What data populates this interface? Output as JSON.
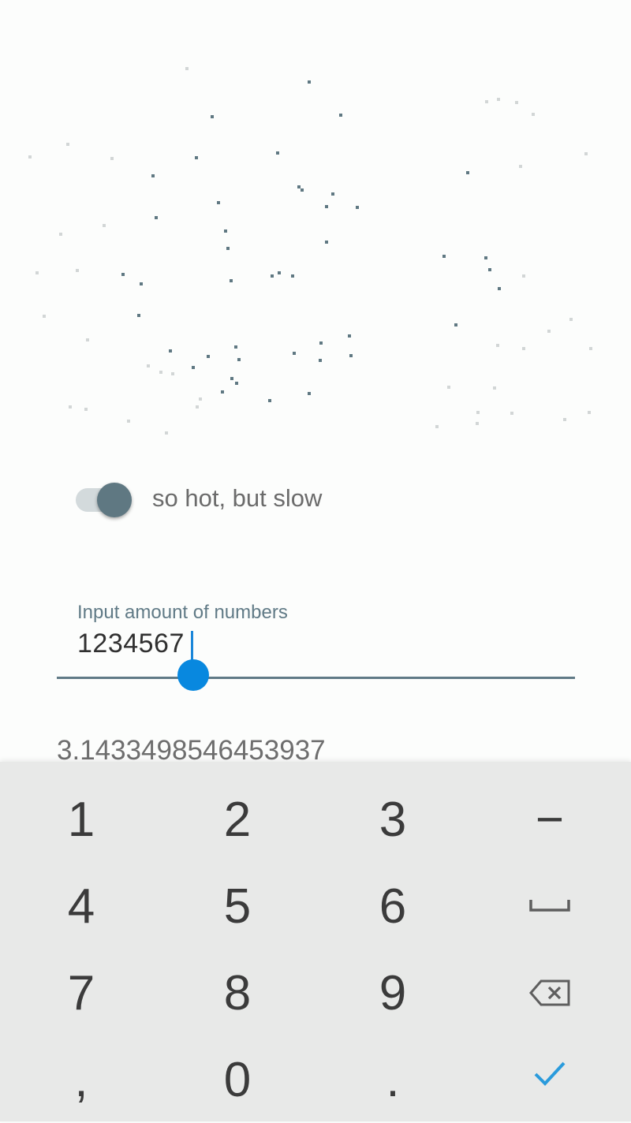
{
  "toggle": {
    "label": "so hot, but slow",
    "on": true
  },
  "input": {
    "label": "Input amount of numbers",
    "value": "1234567"
  },
  "result": {
    "value": "3.1433498546453937"
  },
  "keyboard": {
    "keys": [
      {
        "name": "key-1",
        "label": "1"
      },
      {
        "name": "key-2",
        "label": "2"
      },
      {
        "name": "key-3",
        "label": "3"
      },
      {
        "name": "key-minus",
        "label": "−"
      },
      {
        "name": "key-4",
        "label": "4"
      },
      {
        "name": "key-5",
        "label": "5"
      },
      {
        "name": "key-6",
        "label": "6"
      },
      {
        "name": "key-space",
        "label": "",
        "icon": "space-icon"
      },
      {
        "name": "key-7",
        "label": "7"
      },
      {
        "name": "key-8",
        "label": "8"
      },
      {
        "name": "key-9",
        "label": "9"
      },
      {
        "name": "key-backspace",
        "label": "",
        "icon": "backspace-icon"
      },
      {
        "name": "key-comma",
        "label": ","
      },
      {
        "name": "key-0",
        "label": "0"
      },
      {
        "name": "key-period",
        "label": "."
      },
      {
        "name": "key-done",
        "label": "",
        "icon": "checkmark-icon"
      }
    ]
  },
  "colors": {
    "dot_dark": "#5f7882",
    "dot_light": "#d2d6d6",
    "accent": "#0888df",
    "field": "#607a86",
    "check": "#2a9bdc"
  }
}
